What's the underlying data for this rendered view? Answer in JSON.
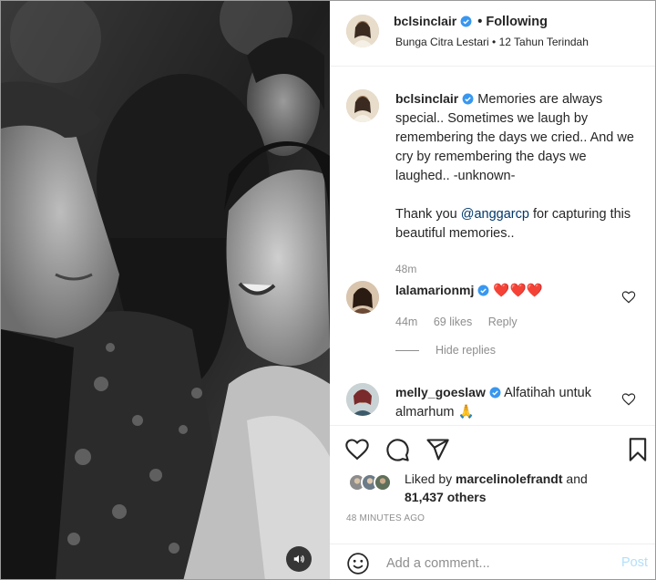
{
  "header": {
    "username": "bclsinclair",
    "following_label": "Following",
    "subtitle": "Bunga Citra Lestari • 12 Tahun Terindah"
  },
  "caption": {
    "username": "bclsinclair",
    "text_before": "Memories are always special.. Sometimes we laugh by remembering the days we cried.. And we cry by remembering the days we laughed.. -unknown-",
    "thank_prefix": "Thank you ",
    "mention": "@anggarcp",
    "thank_suffix": " for capturing this beautiful memories..",
    "time": "48m"
  },
  "comments": [
    {
      "username": "lalamarionmj",
      "text": "❤️❤️❤️",
      "time": "44m",
      "likes": "69 likes",
      "reply": "Reply"
    },
    {
      "username": "melly_goeslaw",
      "text": "Alfatihah untuk almarhum 🙏"
    }
  ],
  "hide_replies": "Hide replies",
  "likes": {
    "prefix": "Liked by ",
    "user": "marcelinolefrandt",
    "mid": " and ",
    "others": "81,437 others"
  },
  "timestamp": "48 MINUTES AGO",
  "add_comment": {
    "placeholder": "Add a comment...",
    "post_label": "Post"
  },
  "icons": {
    "verified": "verified-badge-icon",
    "heart": "heart-icon",
    "comment": "comment-bubble-icon",
    "share": "paper-plane-icon",
    "save": "bookmark-icon",
    "emoji": "smiley-icon",
    "sound": "speaker-icon"
  },
  "colors": {
    "verified_blue": "#3897f0",
    "link_blue": "#00376b",
    "post_disabled": "#b2dffc",
    "meta_grey": "#8e8e8e",
    "text": "#262626"
  }
}
